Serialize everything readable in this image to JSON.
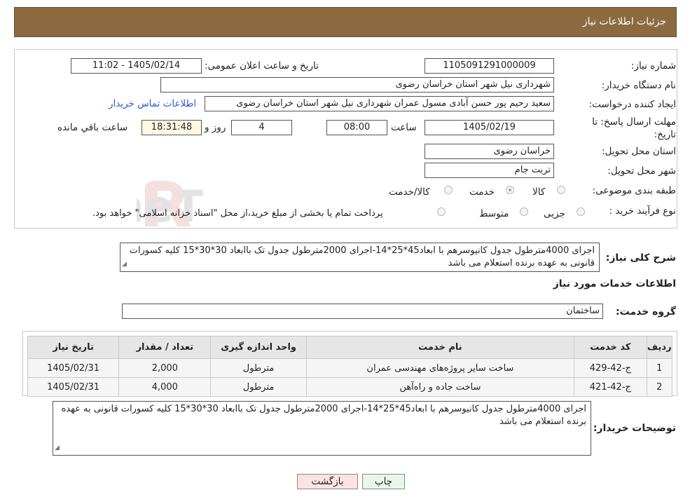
{
  "header": {
    "title": "جزئیات اطلاعات نیاز"
  },
  "fields": {
    "need_number": {
      "label": "شماره نیاز:",
      "value": "1105091291000009"
    },
    "announce_datetime": {
      "label": "تاریخ و ساعت اعلان عمومی:",
      "value": "1405/02/14 - 11:02"
    },
    "buyer_org": {
      "label": "نام دستگاه خریدار:",
      "value": "شهرداری نیل شهر استان خراسان رضوی"
    },
    "requester": {
      "label": "ایجاد کننده درخواست:",
      "value": "سعید رحیم پور حسن آبادی مسول عمران شهرداری نیل شهر استان خراسان رضوی",
      "contact_link": "اطلاعات تماس خریدار"
    },
    "deadline": {
      "label": "مهلت ارسال پاسخ: تا تاریخ:",
      "date": "1405/02/19",
      "time_label": "ساعت",
      "time": "08:00",
      "days": "4",
      "days_label": "روز و",
      "remaining": "18:31:48",
      "remaining_label": "ساعت باقي مانده"
    },
    "delivery_province": {
      "label": "استان محل تحویل:",
      "value": "خراسان رضوی"
    },
    "delivery_city": {
      "label": "شهر محل تحویل:",
      "value": "تربت جام"
    },
    "category": {
      "label": "طبقه بندی موضوعی:",
      "options": [
        "کالا",
        "خدمت",
        "کالا/خدمت"
      ],
      "selected": "خدمت"
    },
    "purchase_type": {
      "label": "نوع فرآیند خرید :",
      "options": [
        "جزیی",
        "متوسط"
      ],
      "note": "پرداخت تمام یا بخشی از مبلغ خرید،از محل \"اسناد خزانه اسلامی\" خواهد بود."
    }
  },
  "general_description": {
    "label": "شرح کلی نیاز:",
    "text": "اجرای 4000مترطول جدول کانیوسرهم با ابعاد45*25*14-اجرای 2000مترطول جدول تک  باابعاد 30*30*15 کلیه کسورات قانونی به عهده برنده استعلام می باشد"
  },
  "services_section": {
    "title": "اطلاعات خدمات مورد نیاز",
    "group_label": "گروه خدمت:",
    "group_value": "ساختمان"
  },
  "table": {
    "headers": [
      "ردیف",
      "کد خدمت",
      "نام خدمت",
      "واحد اندازه گیری",
      "تعداد / مقدار",
      "تاریخ نیاز"
    ],
    "rows": [
      {
        "row": "1",
        "code": "ج-42-429",
        "name": "ساخت سایر پروژه‌های مهندسی عمران",
        "unit": "مترطول",
        "qty": "2,000",
        "date": "1405/02/31"
      },
      {
        "row": "2",
        "code": "ج-42-421",
        "name": "ساخت جاده و راه‌آهن",
        "unit": "مترطول",
        "qty": "4,000",
        "date": "1405/02/31"
      }
    ]
  },
  "buyer_notes": {
    "label": "توضیحات خریدار:",
    "text": "اجرای 4000مترطول جدول کانیوسرهم با ابعاد45*25*14-اجرای 2000مترطول جدول تک  باابعاد 30*30*15 کلیه کسورات قانونی به عهده برنده استعلام می باشد"
  },
  "buttons": {
    "print": "چاپ",
    "back": "بازگشت"
  },
  "watermark": {
    "text": "AriaTender.neT"
  },
  "colors": {
    "header_bg": "#8b6a40",
    "link": "#2d5ad2",
    "back_button_bg": "#fde2e2",
    "print_button_bg": "#e9f7e9",
    "remaining_bg": "#fff9e3"
  }
}
